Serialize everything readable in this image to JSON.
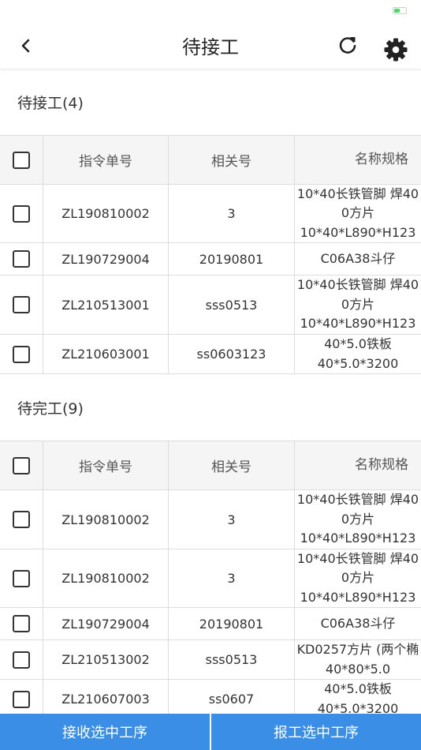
{
  "nav": {
    "title": "待接工"
  },
  "colors": {
    "accent": "#3a8ee6",
    "battery": "#4cd964"
  },
  "columns": [
    "指令单号",
    "相关号",
    "名称规格"
  ],
  "section1": {
    "title": "待接工(4)",
    "rows": [
      {
        "order": "ZL190810002",
        "ref": "3",
        "spec": [
          "10*40长铁管脚 焊40",
          "0方片",
          "10*40*L890*H123"
        ]
      },
      {
        "order": "ZL190729004",
        "ref": "20190801",
        "spec": [
          "C06A38斗仔"
        ]
      },
      {
        "order": "ZL210513001",
        "ref": "sss0513",
        "spec": [
          "10*40长铁管脚 焊40",
          "0方片",
          "10*40*L890*H123"
        ]
      },
      {
        "order": "ZL210603001",
        "ref": "ss0603123",
        "spec": [
          "40*5.0铁板",
          "40*5.0*3200"
        ]
      }
    ]
  },
  "section2": {
    "title": "待完工(9)",
    "rows": [
      {
        "order": "ZL190810002",
        "ref": "3",
        "spec": [
          "10*40长铁管脚 焊40",
          "0方片",
          "10*40*L890*H123"
        ]
      },
      {
        "order": "ZL190810002",
        "ref": "3",
        "spec": [
          "10*40长铁管脚 焊40",
          "0方片",
          "10*40*L890*H123"
        ]
      },
      {
        "order": "ZL190729004",
        "ref": "20190801",
        "spec": [
          "C06A38斗仔"
        ]
      },
      {
        "order": "ZL210513002",
        "ref": "sss0513",
        "spec": [
          "KD0257方片 (两个椭",
          "40*80*5.0"
        ]
      },
      {
        "order": "ZL210607003",
        "ref": "ss0607",
        "spec": [
          "40*5.0铁板",
          "40*5.0*3200"
        ]
      }
    ]
  },
  "footer": {
    "receive_label": "接收选中工序",
    "report_label": "报工选中工序"
  }
}
